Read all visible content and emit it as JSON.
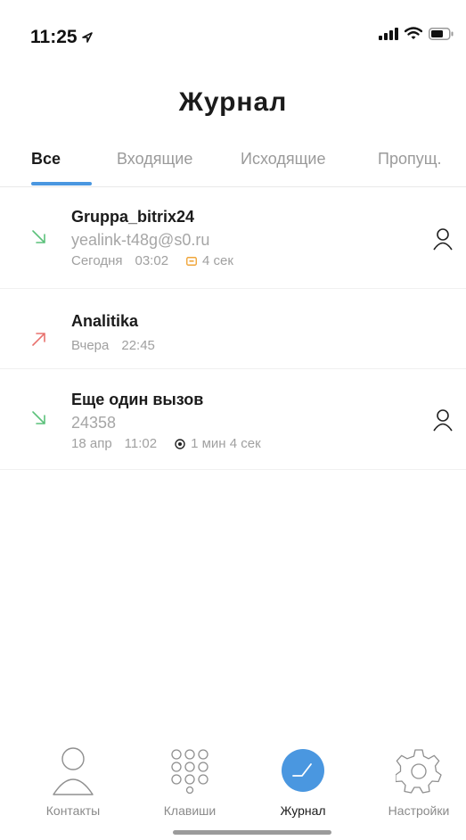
{
  "status_bar": {
    "time": "11:25",
    "icons": [
      "location-arrow-icon",
      "signal-icon",
      "wifi-icon",
      "battery-icon"
    ]
  },
  "header": {
    "title": "Журнал"
  },
  "tabs": [
    {
      "label": "Все",
      "active": true
    },
    {
      "label": "Входящие",
      "active": false
    },
    {
      "label": "Исходящие",
      "active": false
    },
    {
      "label": "Пропущ.",
      "active": false
    }
  ],
  "calls": [
    {
      "direction": "incoming",
      "name": "Gruppa_bitrix24",
      "number": "yealink-t48g@s0.ru",
      "date": "Сегодня",
      "time": "03:02",
      "duration": "4 сек",
      "duration_icon": "voicemail-icon",
      "has_contact": true
    },
    {
      "direction": "outgoing",
      "name": "Analitika",
      "number": "",
      "date": "Вчера",
      "time": "22:45",
      "duration": "",
      "has_contact": false
    },
    {
      "direction": "incoming",
      "name": "Еще один вызов",
      "number": "24358",
      "date": "18 апр",
      "time": "11:02",
      "duration": "1 мин  4 сек",
      "duration_icon": "play-record-icon",
      "has_contact": true
    }
  ],
  "colors": {
    "accent": "#4a97e0",
    "incoming": "#5cc17b",
    "outgoing": "#e8726e",
    "muted": "#a0a0a0"
  },
  "tab_bar": [
    {
      "label": "Контакты",
      "icon": "person-icon",
      "active": false
    },
    {
      "label": "Клавиши",
      "icon": "keypad-icon",
      "active": false
    },
    {
      "label": "Журнал",
      "icon": "call-log-icon",
      "active": true
    },
    {
      "label": "Настройки",
      "icon": "gear-icon",
      "active": false
    }
  ]
}
